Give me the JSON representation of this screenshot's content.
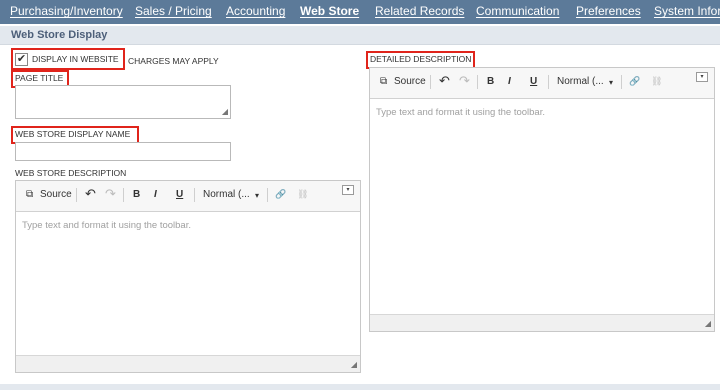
{
  "tabs": [
    {
      "label": "Purchasing/Inventory",
      "active": false
    },
    {
      "label": "Sales / Pricing",
      "active": false
    },
    {
      "label": "Accounting",
      "active": false
    },
    {
      "label": "Web Store",
      "active": true
    },
    {
      "label": "Related Records",
      "active": false
    },
    {
      "label": "Communication",
      "active": false
    },
    {
      "label": "Preferences",
      "active": false
    },
    {
      "label": "System Infor",
      "active": false
    }
  ],
  "section": {
    "title": "Web Store Display"
  },
  "fields": {
    "display_in_website": {
      "label": "DISPLAY IN WEBSITE",
      "checked": true,
      "check_glyph": "✔",
      "note": "CHARGES MAY APPLY"
    },
    "page_title": {
      "label": "PAGE TITLE",
      "value": ""
    },
    "web_store_display_name": {
      "label": "WEB STORE DISPLAY NAME",
      "value": ""
    },
    "web_store_description": {
      "label": "WEB STORE DESCRIPTION",
      "placeholder": "Type text and format it using the toolbar."
    },
    "detailed_description": {
      "label": "DETAILED DESCRIPTION",
      "placeholder": "Type text and format it using the toolbar."
    }
  },
  "toolbar": {
    "source_icon": "⧉",
    "source": "Source",
    "undo_icon": "↶",
    "redo_icon": "↷",
    "bold": "B",
    "italic": "I",
    "underline": "U",
    "format": "Normal (...",
    "dropdown_icon": "▾",
    "link_icon": "🔗",
    "unlink_icon": "⛓",
    "collapse_icon": "▾",
    "resize_icon": "◢"
  },
  "colors": {
    "tab_bar": "#5c7a99",
    "section_header": "#e3e8ee",
    "highlight": "#e0241b"
  }
}
